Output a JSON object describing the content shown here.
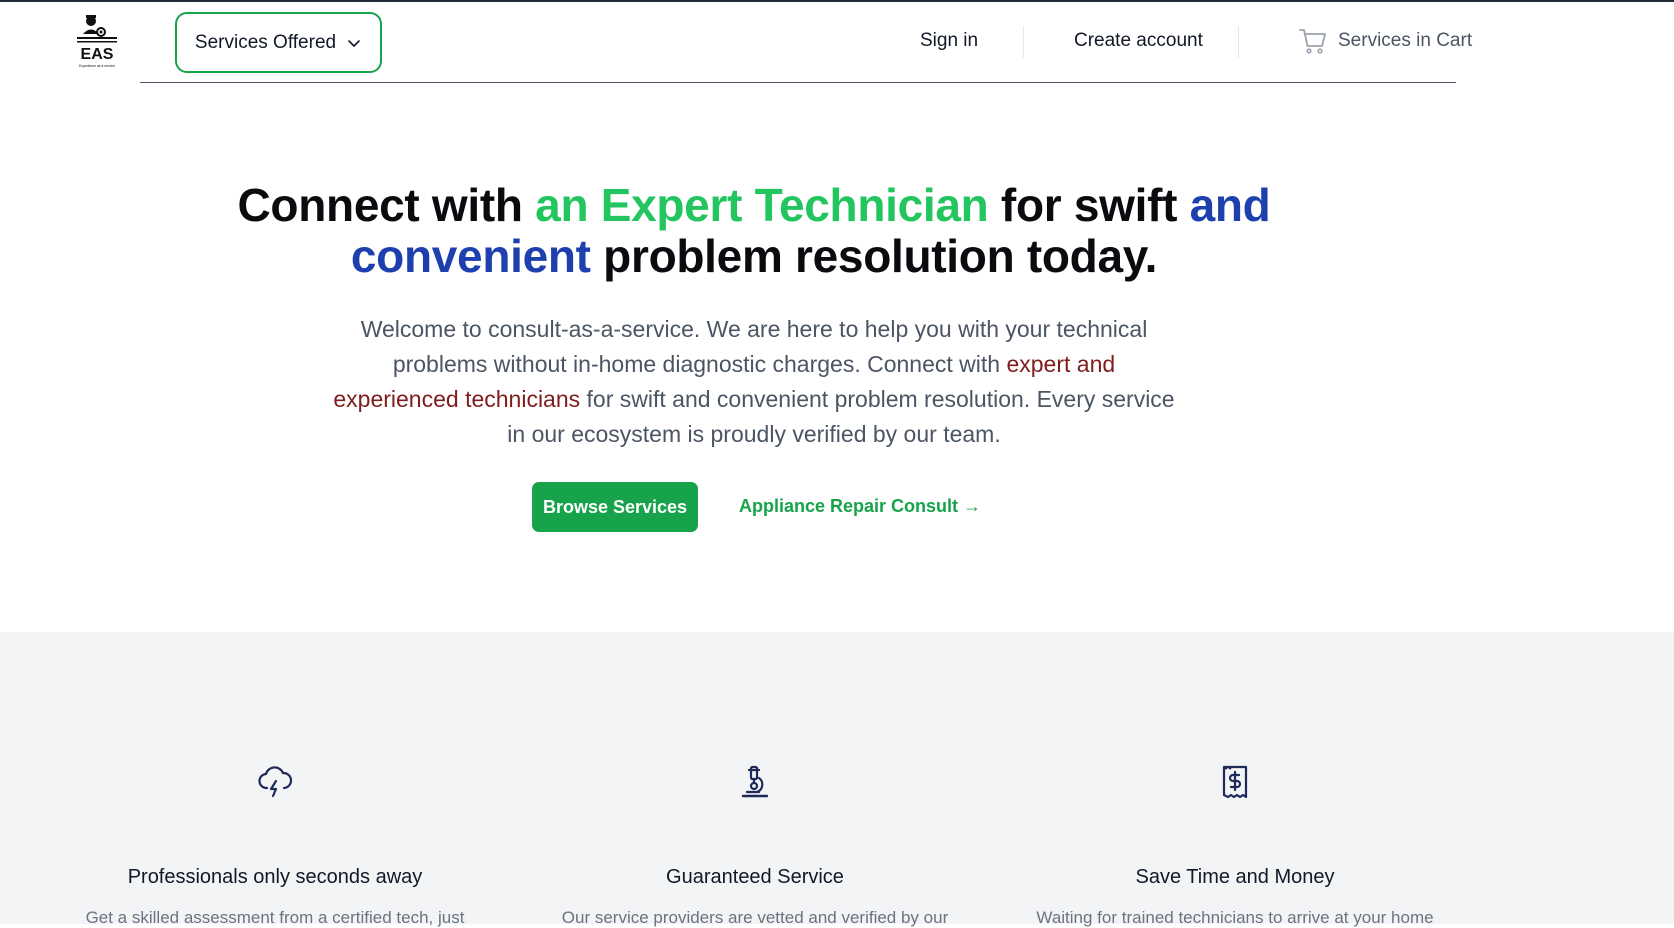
{
  "header": {
    "logo_text": "EAS",
    "logo_tagline": "Experience as a service",
    "services_button": "Services Offered",
    "sign_in": "Sign in",
    "create_account": "Create account",
    "cart_label": "Services in Cart"
  },
  "hero": {
    "title_part1": "Connect with ",
    "title_green": "an Expert Technician",
    "title_part2": " for swift ",
    "title_blue": "and convenient",
    "title_part3": " problem resolution today.",
    "text_part1": "Welcome to consult-as-a-service. We are here to help you with your technical problems without in-home diagnostic charges. Connect with ",
    "text_red": "expert and experienced technicians",
    "text_part2": " for swift and convenient problem resolution. Every service in our ecosystem is proudly verified by our team.",
    "browse_button": "Browse Services",
    "consult_link": "Appliance Repair Consult →"
  },
  "features": [
    {
      "icon": "cloud-lightning-icon",
      "title": "Professionals only seconds away",
      "desc": "Get a skilled assessment from a certified tech, just"
    },
    {
      "icon": "microscope-icon",
      "title": "Guaranteed Service",
      "desc": "Our service providers are vetted and verified by our"
    },
    {
      "icon": "receipt-dollar-icon",
      "title": "Save Time and Money",
      "desc": "Waiting for trained technicians to arrive at your home"
    }
  ],
  "colors": {
    "accent_green": "#16a34a",
    "headline_green": "#22c55e",
    "headline_blue": "#1e40af",
    "text_red": "#7f1d1d",
    "icon_navy": "#1e2a5a"
  }
}
